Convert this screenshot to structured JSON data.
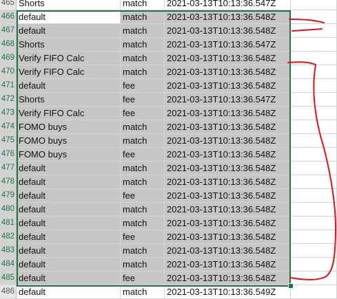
{
  "sheet": {
    "rows": [
      {
        "num": "465",
        "a": "Shorts",
        "b": "match",
        "c": "2021-03-13T10:13:36.547Z",
        "selected": false
      },
      {
        "num": "466",
        "a": "default",
        "b": "match",
        "c": "2021-03-13T10:13:36.548Z",
        "selected": true,
        "active": true
      },
      {
        "num": "467",
        "a": "default",
        "b": "match",
        "c": "2021-03-13T10:13:36.548Z",
        "selected": true
      },
      {
        "num": "468",
        "a": "Shorts",
        "b": "match",
        "c": "2021-03-13T10:13:36.547Z",
        "selected": true
      },
      {
        "num": "469",
        "a": "Verify FIFO Calc",
        "b": "match",
        "c": "2021-03-13T10:13:36.548Z",
        "selected": true
      },
      {
        "num": "470",
        "a": "Verify FIFO Calc",
        "b": "match",
        "c": "2021-03-13T10:13:36.548Z",
        "selected": true
      },
      {
        "num": "471",
        "a": "default",
        "b": "fee",
        "c": "2021-03-13T10:13:36.548Z",
        "selected": true
      },
      {
        "num": "472",
        "a": "Shorts",
        "b": "fee",
        "c": "2021-03-13T10:13:36.547Z",
        "selected": true
      },
      {
        "num": "473",
        "a": "Verify FIFO Calc",
        "b": "fee",
        "c": "2021-03-13T10:13:36.548Z",
        "selected": true
      },
      {
        "num": "474",
        "a": "FOMO buys",
        "b": "match",
        "c": "2021-03-13T10:13:36.548Z",
        "selected": true
      },
      {
        "num": "475",
        "a": "FOMO buys",
        "b": "match",
        "c": "2021-03-13T10:13:36.548Z",
        "selected": true
      },
      {
        "num": "476",
        "a": "FOMO buys",
        "b": "fee",
        "c": "2021-03-13T10:13:36.548Z",
        "selected": true
      },
      {
        "num": "477",
        "a": "default",
        "b": "match",
        "c": "2021-03-13T10:13:36.548Z",
        "selected": true
      },
      {
        "num": "478",
        "a": "default",
        "b": "match",
        "c": "2021-03-13T10:13:36.548Z",
        "selected": true
      },
      {
        "num": "479",
        "a": "default",
        "b": "fee",
        "c": "2021-03-13T10:13:36.548Z",
        "selected": true
      },
      {
        "num": "480",
        "a": "default",
        "b": "match",
        "c": "2021-03-13T10:13:36.548Z",
        "selected": true
      },
      {
        "num": "481",
        "a": "default",
        "b": "match",
        "c": "2021-03-13T10:13:36.548Z",
        "selected": true
      },
      {
        "num": "482",
        "a": "default",
        "b": "fee",
        "c": "2021-03-13T10:13:36.548Z",
        "selected": true
      },
      {
        "num": "483",
        "a": "default",
        "b": "match",
        "c": "2021-03-13T10:13:36.548Z",
        "selected": true
      },
      {
        "num": "484",
        "a": "default",
        "b": "match",
        "c": "2021-03-13T10:13:36.548Z",
        "selected": true
      },
      {
        "num": "485",
        "a": "default",
        "b": "fee",
        "c": "2021-03-13T10:13:36.548Z",
        "selected": true
      },
      {
        "num": "486",
        "a": "default",
        "b": "match",
        "c": "2021-03-13T10:13:36.549Z",
        "selected": false
      }
    ]
  },
  "colors": {
    "selection_border": "#217346",
    "selection_fill": "#c6c6c6",
    "annotation_ink": "#e3101a"
  }
}
